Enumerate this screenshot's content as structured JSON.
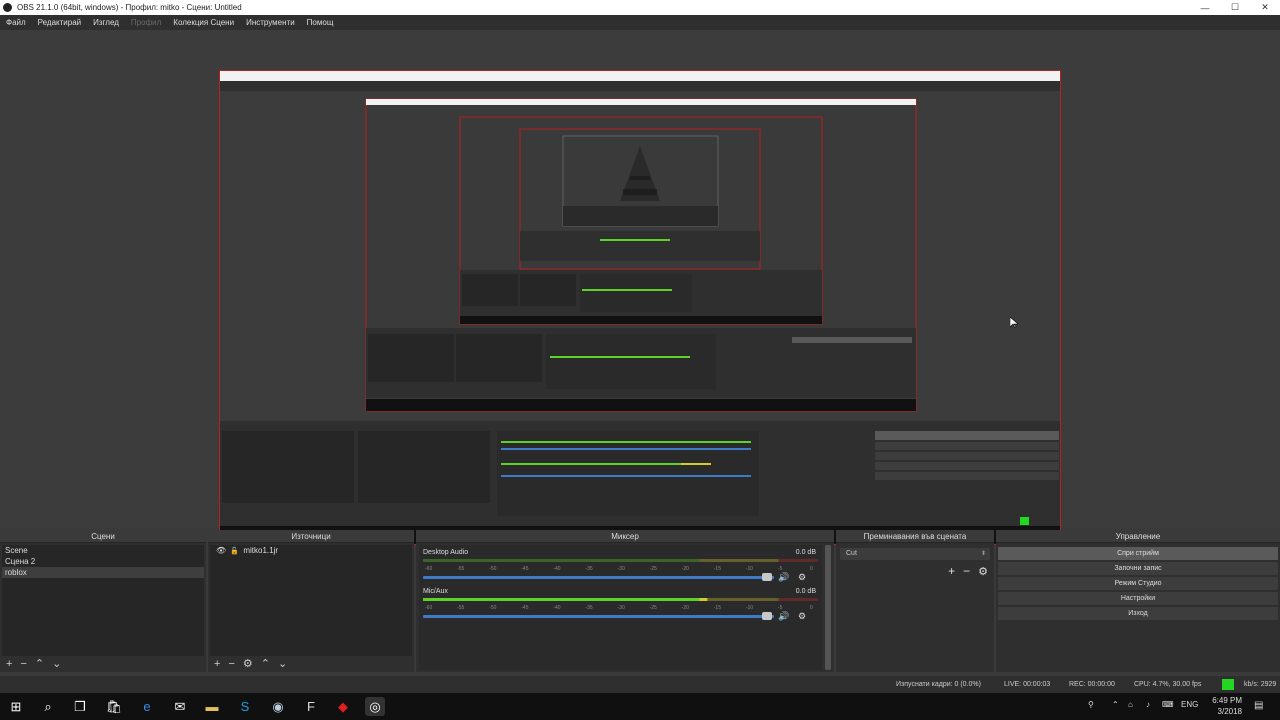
{
  "window": {
    "title": "OBS 21.1.0 (64bit, windows) - Профил: mitko - Сцени: Untitled",
    "min": "—",
    "max": "☐",
    "close": "✕"
  },
  "menu": {
    "items": [
      {
        "label": "Файл"
      },
      {
        "label": "Редактирай"
      },
      {
        "label": "Изглед"
      },
      {
        "label": "Профил"
      },
      {
        "label": "Колекция Сцени"
      },
      {
        "label": "Инструменти"
      },
      {
        "label": "Помощ"
      }
    ]
  },
  "scenes": {
    "header": "Сцени",
    "items": [
      "Scene",
      "Сцена 2",
      "roblox"
    ],
    "selected_index": 2
  },
  "sources": {
    "header": "Източници",
    "items": [
      {
        "label": "mitko1.1jr",
        "visible": true,
        "locked": false
      }
    ]
  },
  "mixer": {
    "header": "Миксер",
    "channels": [
      {
        "name": "Desktop Audio",
        "db": "0.0 dB",
        "level": 0.0
      },
      {
        "name": "Mic/Aux",
        "db": "0.0 dB",
        "level": 0.72
      }
    ],
    "scale_labels": [
      "-60",
      "-55",
      "-50",
      "-45",
      "-40",
      "-35",
      "-30",
      "-25",
      "-20",
      "-15",
      "-10",
      "-5",
      "0"
    ]
  },
  "transitions": {
    "header": "Преминавания във сцената",
    "selected": "Cut"
  },
  "controls": {
    "header": "Управление",
    "buttons": [
      {
        "label": "Спри стрийм"
      },
      {
        "label": "Започни запис"
      },
      {
        "label": "Режим Студио"
      },
      {
        "label": "Настройки"
      },
      {
        "label": "Изход"
      }
    ]
  },
  "status": {
    "dropped": "Изпуснати кадри: 0 (0.0%)",
    "live": "LIVE: 00:00:03",
    "rec": "REC: 00:00:00",
    "cpu": "CPU: 4.7%, 30.00 fps",
    "kbps": "kb/s: 2929",
    "indicator_color": "#23d723"
  },
  "taskbar": {
    "lang": "ENG",
    "time": "6:49 PM",
    "date": "3/2018"
  },
  "colors": {
    "accent_red": "#b72020",
    "fader_blue": "#3d7bc7",
    "meter_green": "#5fd22a",
    "meter_yellow": "#d6c92b",
    "meter_red": "#c42a2a"
  }
}
